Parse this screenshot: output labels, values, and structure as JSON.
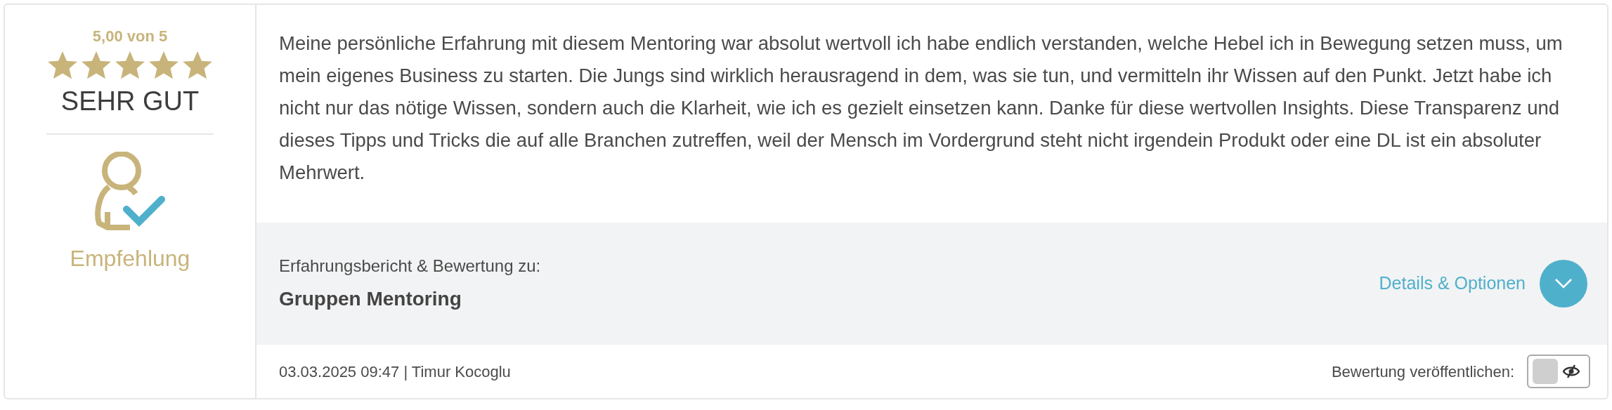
{
  "rating": {
    "score": "5,00 von 5",
    "stars": 5,
    "verdict": "SEHR GUT"
  },
  "recommendation": {
    "label": "Empfehlung"
  },
  "review": {
    "text": "Meine persönliche Erfahrung mit diesem Mentoring war absolut wertvoll ich habe endlich verstanden, welche Hebel ich in Bewegung setzen muss, um mein eigenes Business zu starten. Die Jungs sind wirklich herausragend in dem, was sie tun, und vermitteln ihr Wissen auf den Punkt. Jetzt habe ich nicht nur das nötige Wissen, sondern auch die Klarheit, wie ich es gezielt einsetzen kann. Danke für diese wertvollen Insights. Diese Transparenz und dieses Tipps und Tricks die auf alle Branchen zutreffen, weil der Mensch im Vordergrund steht nicht irgendein Produkt oder eine DL ist ein absoluter Mehrwert."
  },
  "subject": {
    "caption": "Erfahrungsbericht & Bewertung zu:",
    "name": "Gruppen Mentoring",
    "details_link": "Details & Optionen",
    "expanded": false
  },
  "footer": {
    "meta": "03.03.2025 09:47 | Timur Kocoglu",
    "publish_label": "Bewertung veröffentlichen:",
    "published": false
  }
}
